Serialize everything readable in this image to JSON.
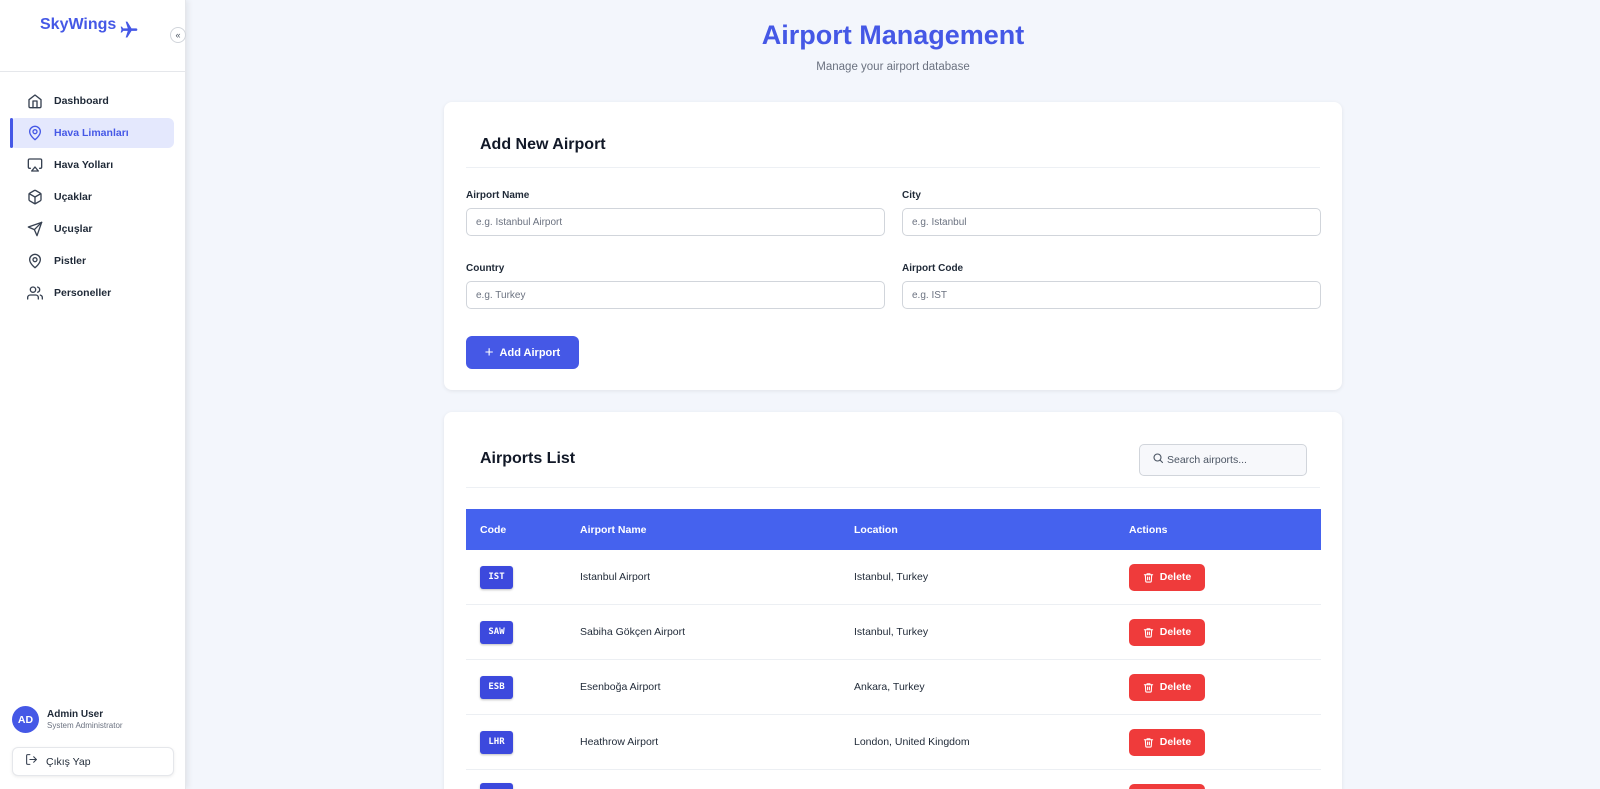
{
  "sidebar": {
    "brand": "SkyWings",
    "collapse_glyph": "«",
    "items": [
      {
        "label": "Dashboard",
        "icon": "home-icon"
      },
      {
        "label": "Hava Limanları",
        "icon": "map-pin-icon",
        "active": true
      },
      {
        "label": "Hava Yolları",
        "icon": "airplay-icon"
      },
      {
        "label": "Uçaklar",
        "icon": "package-icon"
      },
      {
        "label": "Uçuşlar",
        "icon": "navigation-icon"
      },
      {
        "label": "Pistler",
        "icon": "map-pin-icon"
      },
      {
        "label": "Personeller",
        "icon": "users-icon"
      }
    ],
    "user": {
      "initials": "AD",
      "name": "Admin User",
      "role": "System Administrator"
    },
    "logout_label": "Çıkış Yap"
  },
  "header": {
    "title": "Airport Management",
    "subtitle": "Manage your airport database"
  },
  "add_form": {
    "title": "Add New Airport",
    "fields": {
      "name": {
        "label": "Airport Name",
        "placeholder": "e.g. Istanbul Airport"
      },
      "city": {
        "label": "City",
        "placeholder": "e.g. Istanbul"
      },
      "country": {
        "label": "Country",
        "placeholder": "e.g. Turkey"
      },
      "code": {
        "label": "Airport Code",
        "placeholder": "e.g. IST"
      }
    },
    "submit_label": "Add Airport"
  },
  "airports_list": {
    "title": "Airports List",
    "search_placeholder": "Search airports...",
    "columns": [
      "Code",
      "Airport Name",
      "Location",
      "Actions"
    ],
    "delete_label": "Delete",
    "rows": [
      {
        "code": "IST",
        "name": "Istanbul Airport",
        "location": "Istanbul, Turkey"
      },
      {
        "code": "SAW",
        "name": "Sabiha Gökçen Airport",
        "location": "Istanbul, Turkey"
      },
      {
        "code": "ESB",
        "name": "Esenboğa Airport",
        "location": "Ankara, Turkey"
      },
      {
        "code": "LHR",
        "name": "Heathrow Airport",
        "location": "London, United Kingdom"
      },
      {
        "code": "",
        "name": "",
        "location": ""
      }
    ]
  },
  "colors": {
    "accent": "#4558e6",
    "table_header": "#4562ee",
    "code_badge": "#3c49dd",
    "danger": "#ef3b3b",
    "background": "#f3f6fc"
  }
}
